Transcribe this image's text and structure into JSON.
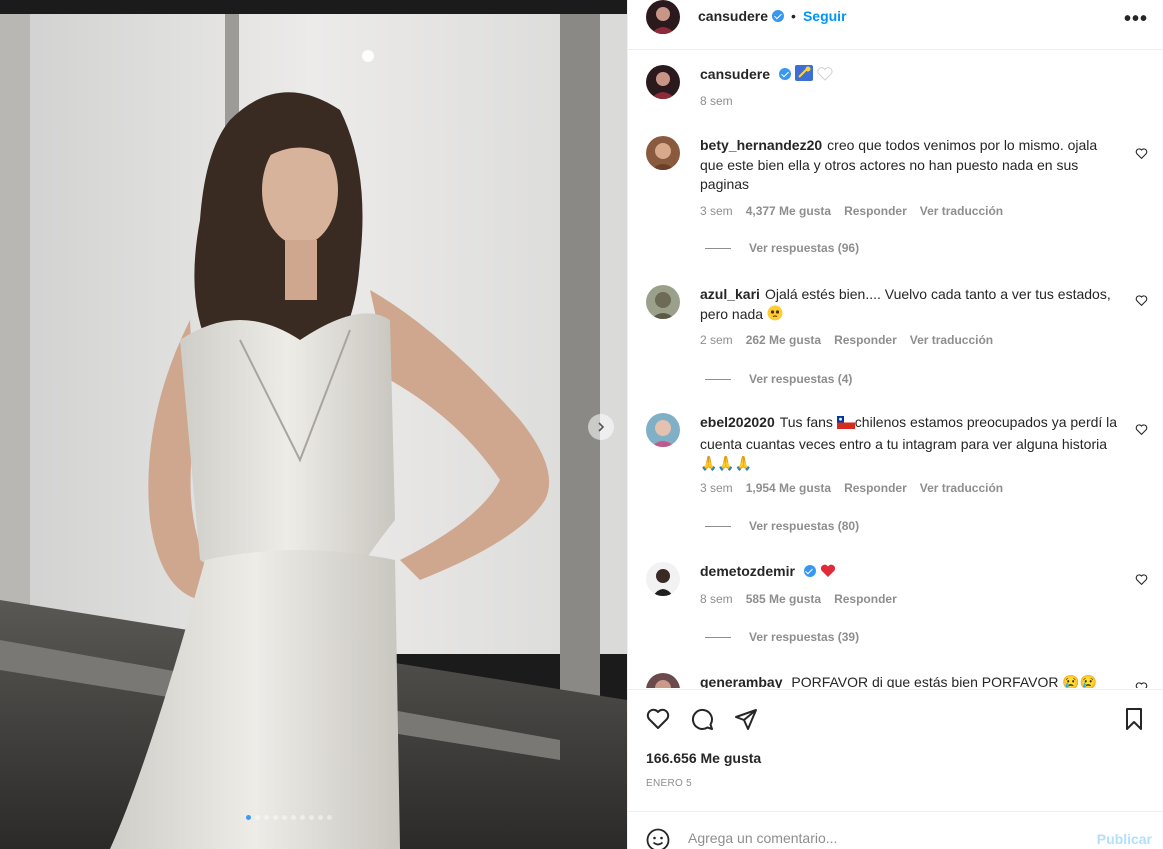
{
  "post": {
    "author": "cansudere",
    "follow_label": "Seguir",
    "more_label": "•••",
    "carousel": {
      "total": 10,
      "current": 1
    }
  },
  "caption": {
    "author": "cansudere",
    "time": "8 sem"
  },
  "comments": [
    {
      "user": "bety_hernandez20",
      "text": "creo que todos venimos por lo mismo. ojala que este bien ella y otros actores no han puesto nada en sus paginas",
      "time": "3 sem",
      "likes": "4,377 Me gusta",
      "reply": "Responder",
      "translate": "Ver traducción",
      "view_replies": "Ver respuestas (96)"
    },
    {
      "user": "azul_kari",
      "text": "Ojalá estés bien.... Vuelvo cada tanto a ver tus estados, pero nada",
      "time": "2 sem",
      "likes": "262 Me gusta",
      "reply": "Responder",
      "translate": "Ver traducción",
      "view_replies": "Ver respuestas (4)"
    },
    {
      "user": "ebel202020",
      "text_before": "Tus fans ",
      "text_after": "chilenos estamos preocupados ya perdí la cuenta cuantas veces entro a tu intagram para ver alguna historia ",
      "emoji_tail": "🙏🙏🙏",
      "time": "3 sem",
      "likes": "1,954 Me gusta",
      "reply": "Responder",
      "translate": "Ver traducción",
      "view_replies": "Ver respuestas (80)"
    },
    {
      "user": "demetozdemir",
      "time": "8 sem",
      "likes": "585 Me gusta",
      "reply": "Responder",
      "view_replies": "Ver respuestas (39)"
    },
    {
      "user": "generambay",
      "text": "PORFAVOR di que estás bien PORFAVOR",
      "emoji_tail": "😢😢"
    }
  ],
  "likes_count": "166.656 Me gusta",
  "post_date": "ENERO 5",
  "add_comment": {
    "placeholder": "Agrega un comentario...",
    "post_label": "Publicar"
  },
  "colors": {
    "accent": "#0095f6",
    "muted": "#8e8e8e",
    "verified": "#3897f0",
    "publish_disabled": "#b2dffc"
  }
}
